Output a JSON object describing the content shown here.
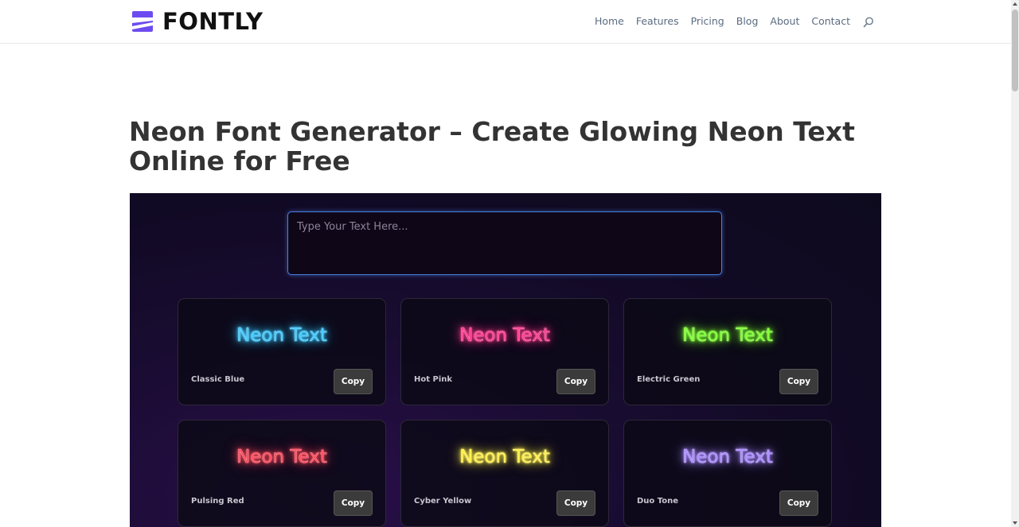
{
  "brand": {
    "name": "FONTLY",
    "accent": "#6c4cf0"
  },
  "nav": {
    "items": [
      "Home",
      "Features",
      "Pricing",
      "Blog",
      "About",
      "Contact"
    ],
    "search_icon": "search-icon"
  },
  "page": {
    "title": "Neon Font Generator – Create Glowing Neon Text Online for Free"
  },
  "generator": {
    "input_placeholder": "Type Your Text Here...",
    "input_value": "",
    "copy_label": "Copy",
    "styles": [
      {
        "preview": "Neon Text",
        "name": "Classic Blue",
        "color": "#3ec9ff"
      },
      {
        "preview": "Neon Text",
        "name": "Hot Pink",
        "color": "#ff3c8e"
      },
      {
        "preview": "Neon Text",
        "name": "Electric Green",
        "color": "#7cff2e"
      },
      {
        "preview": "Neon Text",
        "name": "Pulsing Red",
        "color": "#ff4b5c"
      },
      {
        "preview": "Neon Text",
        "name": "Cyber Yellow",
        "color": "#fff04a"
      },
      {
        "preview": "Neon Text",
        "name": "Duo Tone",
        "color": "#a98bff"
      }
    ]
  }
}
